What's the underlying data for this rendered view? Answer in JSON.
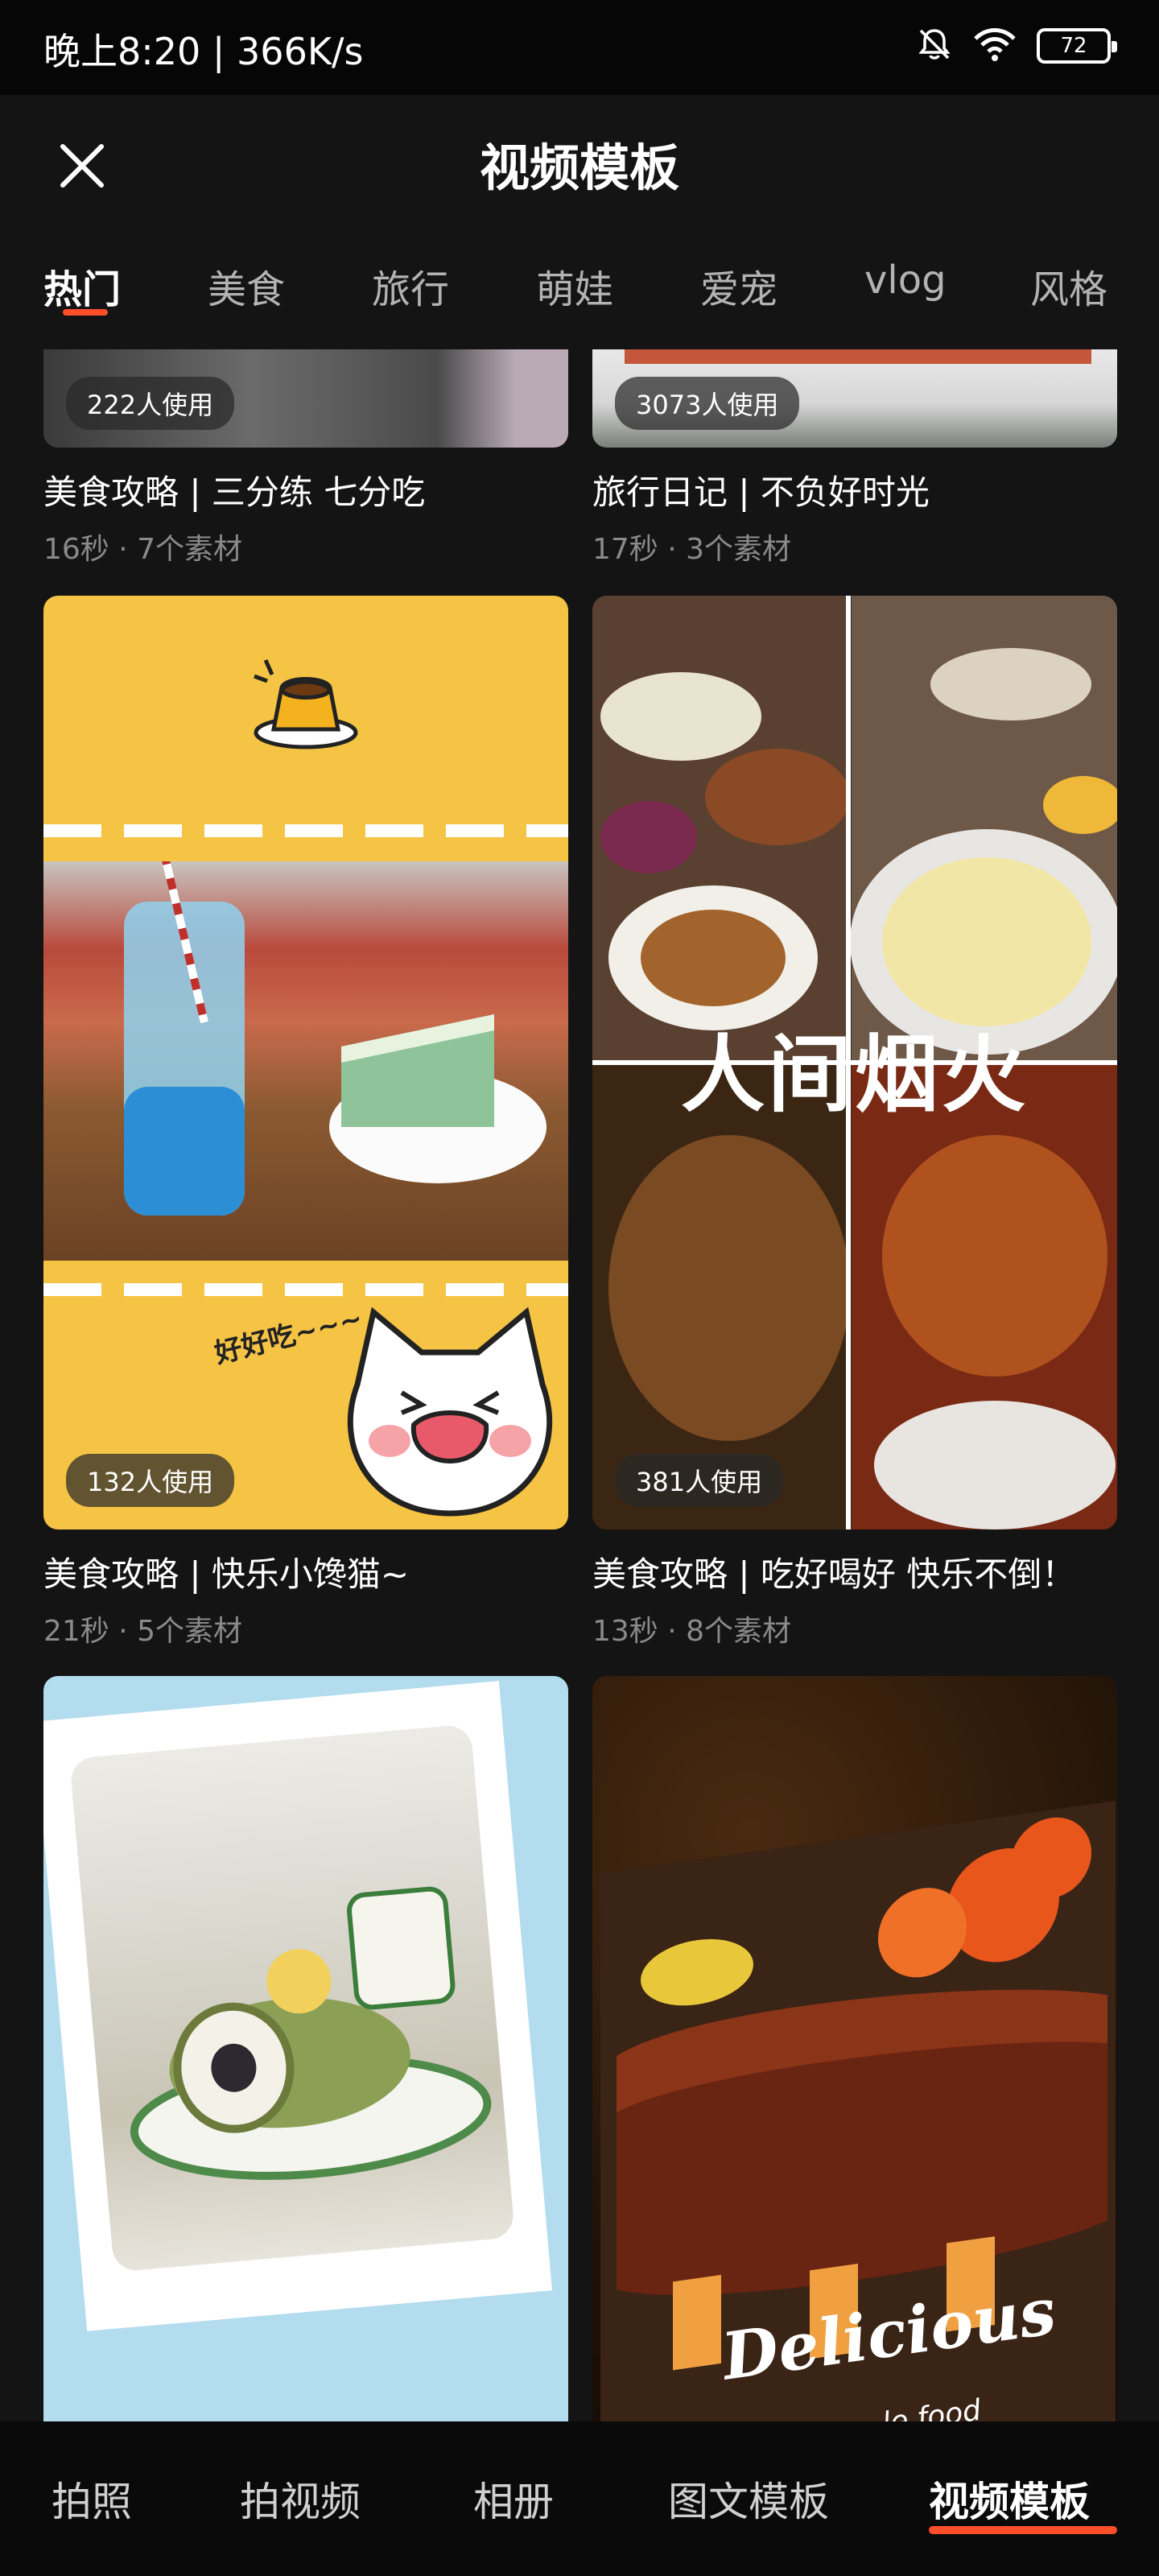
{
  "status_bar": {
    "time_speed": "晚上8:20 | 366K/s",
    "battery": "72",
    "icons": [
      "mute-bell-icon",
      "wifi-icon",
      "battery-icon"
    ]
  },
  "header": {
    "title": "视频模板",
    "close_icon": "close-icon"
  },
  "tabs": [
    {
      "label": "热门",
      "active": true
    },
    {
      "label": "美食"
    },
    {
      "label": "旅行"
    },
    {
      "label": "萌娃"
    },
    {
      "label": "爱宠"
    },
    {
      "label": "vlog"
    },
    {
      "label": "风格"
    }
  ],
  "cards": [
    {
      "usage": "222人使用",
      "title": "美食攻略 | 三分练 七分吃",
      "meta": "16秒 · 7个素材"
    },
    {
      "usage": "3073人使用",
      "title": "旅行日记 | 不负好时光",
      "meta": "17秒 · 3个素材"
    },
    {
      "usage": "132人使用",
      "title": "美食攻略 | 快乐小馋猫~",
      "meta": "21秒 · 5个素材",
      "overlay": "好好吃~~~"
    },
    {
      "usage": "381人使用",
      "title": "美食攻略 | 吃好喝好 快乐不倒！",
      "meta": "13秒 · 8个素材",
      "overlay": "人间烟火"
    },
    {
      "overlay": ""
    },
    {
      "overlay": "Delicious",
      "overlay_sub": "le food"
    }
  ],
  "bottom_nav": [
    {
      "label": "拍照"
    },
    {
      "label": "拍视频"
    },
    {
      "label": "相册"
    },
    {
      "label": "图文模板"
    },
    {
      "label": "视频模板",
      "active": true
    }
  ],
  "colors": {
    "accent": "#ff4e2a",
    "background": "#141414",
    "muted_text": "#8a8a8a"
  }
}
